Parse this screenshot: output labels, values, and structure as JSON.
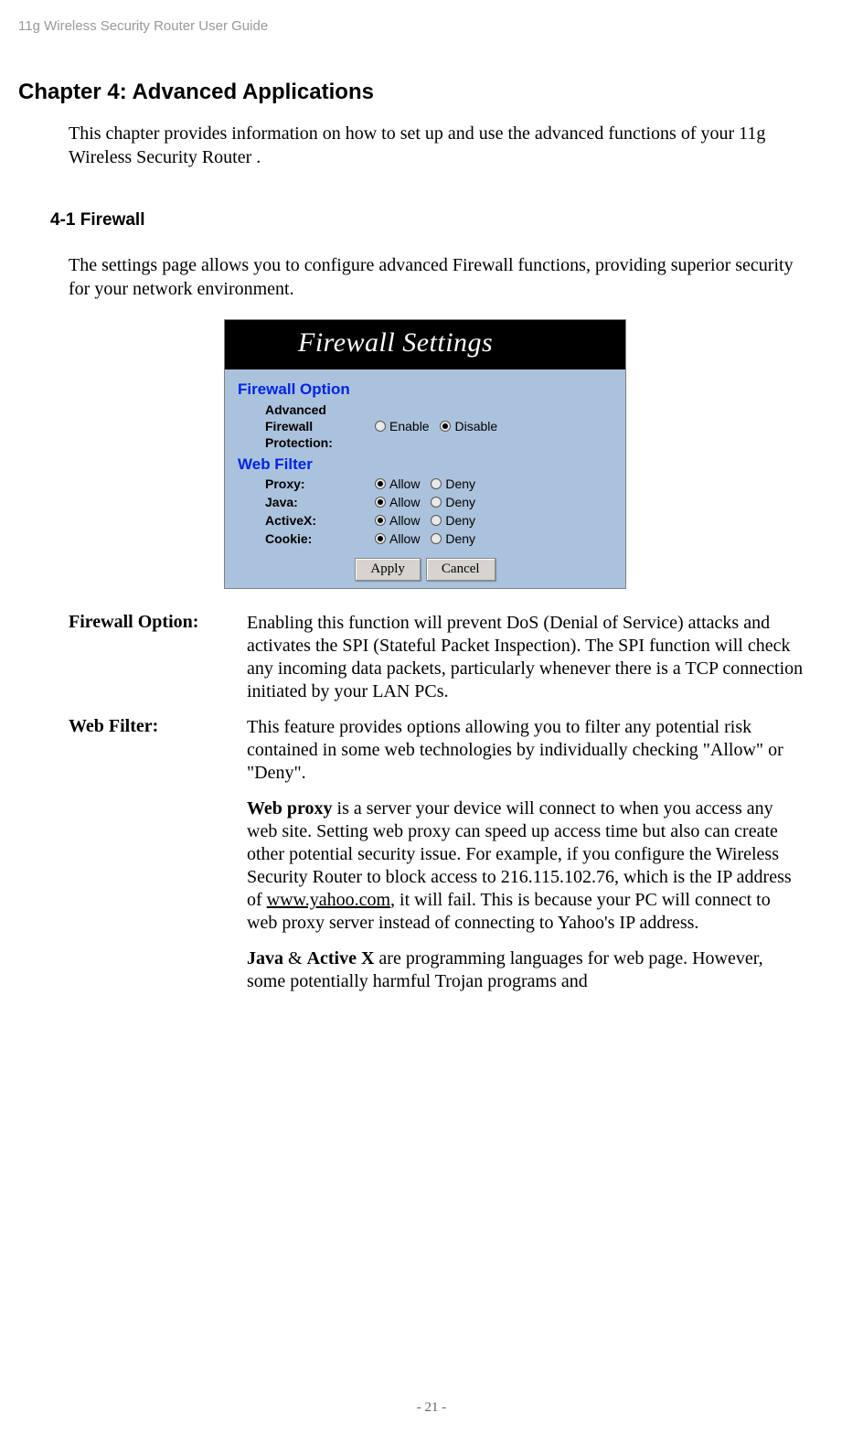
{
  "page_header": "11g Wireless Security Router User Guide",
  "chapter_title": "Chapter 4: Advanced Applications",
  "intro_text": "This chapter provides information on how to set up and use the advanced functions of your 11g Wireless Security Router .",
  "section_title": "4-1 Firewall",
  "section_text": "The settings page allows you to configure advanced Firewall functions, providing superior security for your network environment.",
  "router_ui": {
    "title": "Firewall Settings",
    "firewall_option_label": "Firewall Option",
    "web_filter_label": "Web Filter",
    "advanced_firewall_label": "Advanced\nFirewall\nProtection:",
    "enable_label": "Enable",
    "disable_label": "Disable",
    "allow_label": "Allow",
    "deny_label": "Deny",
    "filters": {
      "proxy": "Proxy:",
      "java": "Java:",
      "activex": "ActiveX:",
      "cookie": "Cookie:"
    },
    "apply_btn": "Apply",
    "cancel_btn": "Cancel"
  },
  "definitions": {
    "firewall_option": {
      "term": "Firewall Option:",
      "desc": "Enabling this function will prevent DoS (Denial of Service) attacks and activates the SPI (Stateful Packet Inspection). The SPI function will check any incoming data packets, particularly whenever there is a TCP connection initiated by your LAN PCs."
    },
    "web_filter": {
      "term": "Web Filter:",
      "desc": "This feature provides options allowing you to filter any potential risk contained in some web technologies by individually checking \"Allow\" or \"Deny\".",
      "proxy_pre": "Web proxy",
      "proxy_mid": " is a server your device will connect to when you access any web site. Setting web proxy can speed up access time but also can create other potential security issue. For example, if you configure the Wireless Security Router to block access to 216.115.102.76, which is the IP address of ",
      "proxy_link": "www.yahoo.com",
      "proxy_post": ", it will fail. This is because your PC will connect to web proxy server instead of connecting to Yahoo's IP address.",
      "java_pre": "Java",
      "java_amp": " & ",
      "java_activex": "Active X",
      "java_post": " are programming languages for web page. However, some potentially harmful Trojan programs and"
    }
  },
  "page_number": "- 21 -"
}
